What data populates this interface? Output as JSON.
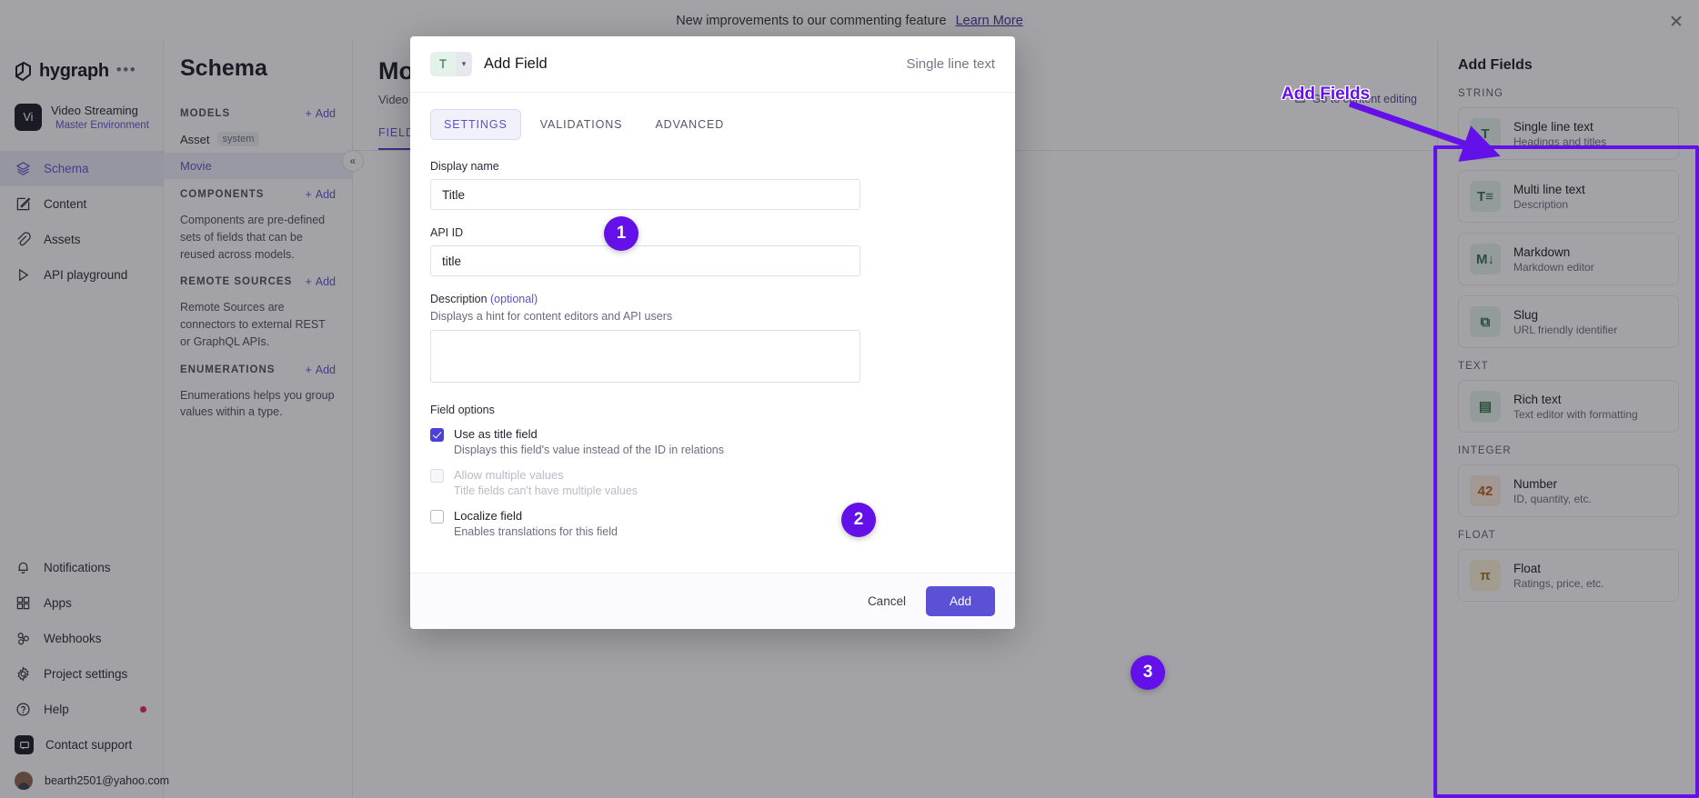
{
  "banner": {
    "text": "New improvements to our commenting feature",
    "link": "Learn More",
    "close_icon": "close-icon"
  },
  "leftnav": {
    "brand": "hygraph",
    "brand_dots": "•••",
    "project": {
      "avatar": "Vi",
      "name": "Video Streaming",
      "environment": "Master Environment"
    },
    "items": [
      {
        "label": "Schema",
        "icon": "layers-icon",
        "active": true
      },
      {
        "label": "Content",
        "icon": "pencil-square-icon",
        "active": false
      },
      {
        "label": "Assets",
        "icon": "paperclip-icon",
        "active": false
      },
      {
        "label": "API playground",
        "icon": "play-triangle-icon",
        "active": false
      }
    ],
    "bottom_items": [
      {
        "label": "Notifications",
        "icon": "bell-icon",
        "dot": false
      },
      {
        "label": "Apps",
        "icon": "grid-squares-icon",
        "dot": false
      },
      {
        "label": "Webhooks",
        "icon": "webhook-icon",
        "dot": false
      },
      {
        "label": "Project settings",
        "icon": "gear-icon",
        "dot": false
      },
      {
        "label": "Help",
        "icon": "question-circle-icon",
        "dot": true
      }
    ],
    "support": {
      "label": "Contact support",
      "icon": "chat-bubble-icon"
    },
    "account": {
      "email": "bearth2501@yahoo.com",
      "icon": "avatar"
    }
  },
  "schema_panel": {
    "title": "Schema",
    "sections": [
      {
        "label": "MODELS",
        "add": "Add",
        "models": [
          {
            "name": "Asset",
            "tag": "system",
            "selected": false
          },
          {
            "name": "Movie",
            "tag": "",
            "selected": true
          }
        ],
        "description": ""
      },
      {
        "label": "COMPONENTS",
        "add": "Add",
        "models": [],
        "description": "Components are pre-defined sets of fields that can be reused across models."
      },
      {
        "label": "REMOTE SOURCES",
        "add": "Add",
        "models": [],
        "description": "Remote Sources are connectors to external REST or GraphQL APIs."
      },
      {
        "label": "ENUMERATIONS",
        "add": "Add",
        "models": [],
        "description": "Enumerations helps you group values within a type."
      }
    ]
  },
  "main": {
    "title": "Movie",
    "subtitle": "Video Streaming",
    "tab": "FIELDS",
    "collapse_icon": "chevron-double-left-icon",
    "go_to_content": "Go to content editing",
    "go_to_content_icon": "external-edit-icon"
  },
  "modal": {
    "type_icon": "T",
    "type_chevron": "chevron-down-icon",
    "title": "Add Field",
    "field_type": "Single line text",
    "tabs": [
      {
        "label": "SETTINGS",
        "active": true
      },
      {
        "label": "VALIDATIONS",
        "active": false
      },
      {
        "label": "ADVANCED",
        "active": false
      }
    ],
    "display_name": {
      "label": "Display name",
      "value": "Title",
      "placeholder": ""
    },
    "api_id": {
      "label": "API ID",
      "value": "title",
      "placeholder": ""
    },
    "description": {
      "label": "Description",
      "optional": "(optional)",
      "hint": "Displays a hint for content editors and API users",
      "value": "",
      "placeholder": ""
    },
    "field_options_title": "Field options",
    "options": [
      {
        "name": "Use as title field",
        "sub": "Displays this field's value instead of the ID in relations",
        "checked": true,
        "disabled": false
      },
      {
        "name": "Allow multiple values",
        "sub": "Title fields can't have multiple values",
        "checked": false,
        "disabled": true
      },
      {
        "name": "Localize field",
        "sub": "Enables translations for this field",
        "checked": false,
        "disabled": false
      }
    ],
    "cancel_label": "Cancel",
    "add_label": "Add"
  },
  "fields_panel": {
    "title": "Add Fields",
    "groups": [
      {
        "label": "STRING",
        "items": [
          {
            "name": "Single line text",
            "desc": "Headings and titles",
            "icon": "T",
            "icon_name": "single-line-text-icon",
            "tone": "green"
          },
          {
            "name": "Multi line text",
            "desc": "Description",
            "icon": "T≡",
            "icon_name": "multi-line-text-icon",
            "tone": "green"
          },
          {
            "name": "Markdown",
            "desc": "Markdown editor",
            "icon": "M↓",
            "icon_name": "markdown-icon",
            "tone": "green"
          },
          {
            "name": "Slug",
            "desc": "URL friendly identifier",
            "icon": "⧉",
            "icon_name": "slug-link-icon",
            "tone": "green"
          }
        ]
      },
      {
        "label": "TEXT",
        "items": [
          {
            "name": "Rich text",
            "desc": "Text editor with formatting",
            "icon": "▤",
            "icon_name": "rich-text-icon",
            "tone": "green"
          }
        ]
      },
      {
        "label": "INTEGER",
        "items": [
          {
            "name": "Number",
            "desc": "ID, quantity, etc.",
            "icon": "42",
            "icon_name": "number-icon",
            "tone": "orange"
          }
        ]
      },
      {
        "label": "FLOAT",
        "items": [
          {
            "name": "Float",
            "desc": "Ratings, price, etc.",
            "icon": "π",
            "icon_name": "float-icon",
            "tone": "yellow"
          }
        ]
      }
    ]
  },
  "annotations": {
    "label_add_fields": "Add Fields",
    "step1": "1",
    "step2": "2",
    "step3": "3",
    "accent": "#6410e8"
  }
}
